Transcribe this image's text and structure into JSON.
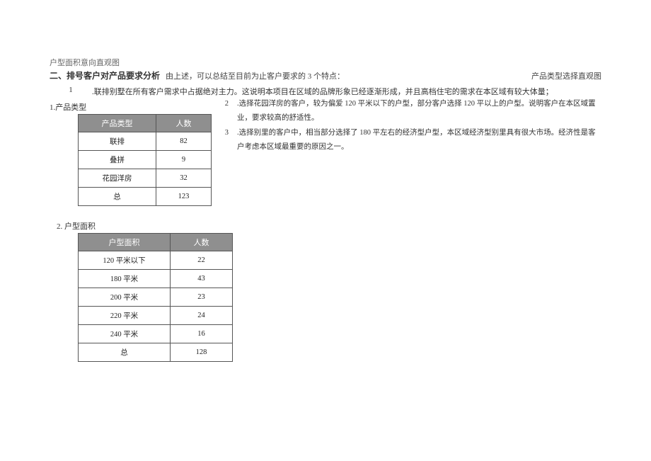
{
  "title_line": "户型面积意向直观图",
  "section_header": "二、排号客户对产品要求分析",
  "intro_text": "由上述，可以总结至目前为止客户要求的 3 个特点：",
  "right_label": "产品类型选择直观图",
  "sub1_label": "1.产品类型",
  "sub2_label": "2. 户型面积",
  "points": [
    {
      "num": "1",
      "text": ".联排别墅在所有客户需求中占据绝对主力。这说明本项目在区域的品牌形象已经逐渐形成，并且高档住宅的需求在本区域有较大体量；"
    },
    {
      "num": "2",
      "text": ".选择花园洋房的客户，较为偏爱 120 平米以下的户型，部分客户选择 120 平以上的户型。说明客户在本区域置业，要求较高的舒适性。"
    },
    {
      "num": "3",
      "text": ".选择别里的客户中，相当部分选择了 180 平左右的经济型户型，本区域经济型别里具有很大市场。经济性是客户考虑本区域最重要的原因之一。"
    }
  ],
  "table1": {
    "headers": [
      "产品类型",
      "人数"
    ],
    "rows": [
      [
        "联排",
        "82"
      ],
      [
        "叠拼",
        "9"
      ],
      [
        "花园洋房",
        "32"
      ],
      [
        "总",
        "123"
      ]
    ]
  },
  "table2": {
    "headers": [
      "户型面积",
      "人数"
    ],
    "rows": [
      [
        "120 平米以下",
        "22"
      ],
      [
        "180 平米",
        "43"
      ],
      [
        "200 平米",
        "23"
      ],
      [
        "220 平米",
        "24"
      ],
      [
        "240 平米",
        "16"
      ],
      [
        "总",
        "128"
      ]
    ]
  }
}
